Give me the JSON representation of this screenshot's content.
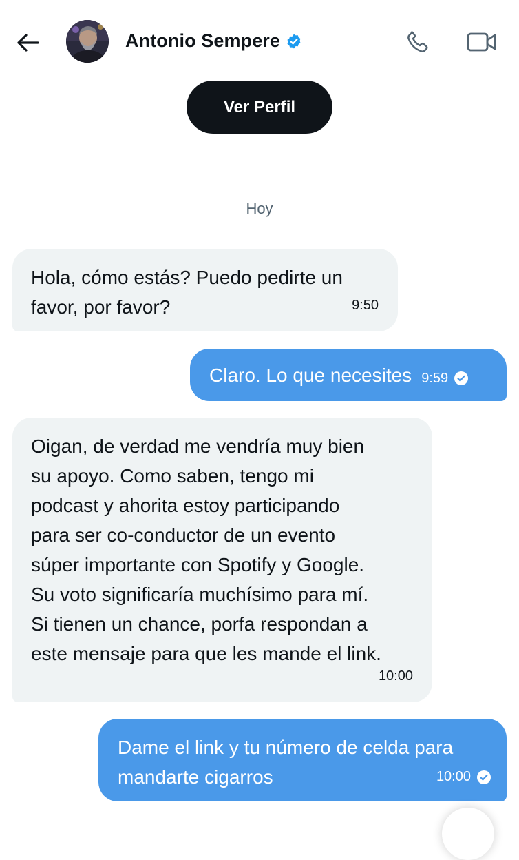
{
  "header": {
    "contact_name": "Antonio Sempere",
    "verified": true,
    "icons": {
      "back": "arrow-left-icon",
      "verified": "verified-badge-icon",
      "call": "phone-icon",
      "video": "video-camera-icon"
    }
  },
  "profile_button": {
    "label": "Ver Perfil"
  },
  "date_separator": "Hoy",
  "messages": [
    {
      "direction": "incoming",
      "text": "Hola, cómo estás? Puedo pedirte un\nfavor, por favor?",
      "time": "9:50"
    },
    {
      "direction": "outgoing",
      "text": "Claro. Lo que necesites",
      "time": "9:59",
      "status": "read"
    },
    {
      "direction": "incoming",
      "text": "Oigan, de verdad me vendría muy bien\nsu apoyo. Como saben, tengo mi\npodcast y ahorita estoy participando\npara ser co-conductor de un evento\nsúper importante con Spotify y Google.\nSu voto significaría muchísimo para mí.\nSi tienen un chance, porfa respondan a\neste mensaje para que les mande el link.",
      "time": "10:00"
    },
    {
      "direction": "outgoing",
      "text": "Dame el link y tu número de celda para\nmandarte cigarros",
      "time": "10:00",
      "status": "read"
    }
  ],
  "colors": {
    "incoming_bubble": "#eff3f4",
    "outgoing_bubble": "#4a99e9",
    "verified_badge": "#1d9bf0",
    "primary_button": "#0f1419",
    "secondary_text": "#536471"
  }
}
